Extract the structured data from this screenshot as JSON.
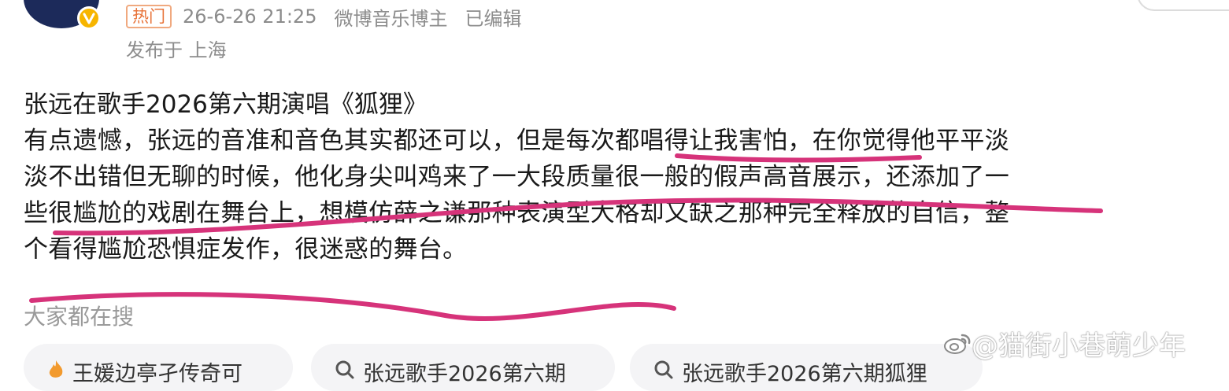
{
  "post": {
    "hot_tag": "热门",
    "timestamp": "26-6-26 21:25",
    "author_role": "微博音乐博主",
    "edited": "已编辑",
    "location": "发布于 上海",
    "title": "张远在歌手2026第六期演唱《狐狸》",
    "body_lines": [
      "有点遗憾，张远的音准和音色其实都还可以，但是每次都唱得让我害怕，在你觉得他平平淡",
      "淡不出错但无聊的时候，他化身尖叫鸡来了一大段质量很一般的假声高音展示，还添加了一",
      "些很尴尬的戏剧在舞台上，想模仿薛之谦那种表演型大格却又缺之那种完全释放的自信，整",
      "个看得尴尬恐惧症发作，很迷惑的舞台。"
    ]
  },
  "search": {
    "label": "大家都在搜",
    "chips": [
      {
        "icon": "hot-icon",
        "text": "王媛边亭孑传奇可"
      },
      {
        "icon": "search-icon",
        "text": "张远歌手2026第六期"
      },
      {
        "icon": "search-icon",
        "text": "张远歌手2026第六期狐狸"
      }
    ]
  },
  "watermark": {
    "text": "@猫街小巷萌少年"
  },
  "colors": {
    "annotation": "#d6337a",
    "hot_tag": "#e8743a",
    "meta_text": "#8c8c8c",
    "verified_badge": "#f7b500"
  }
}
